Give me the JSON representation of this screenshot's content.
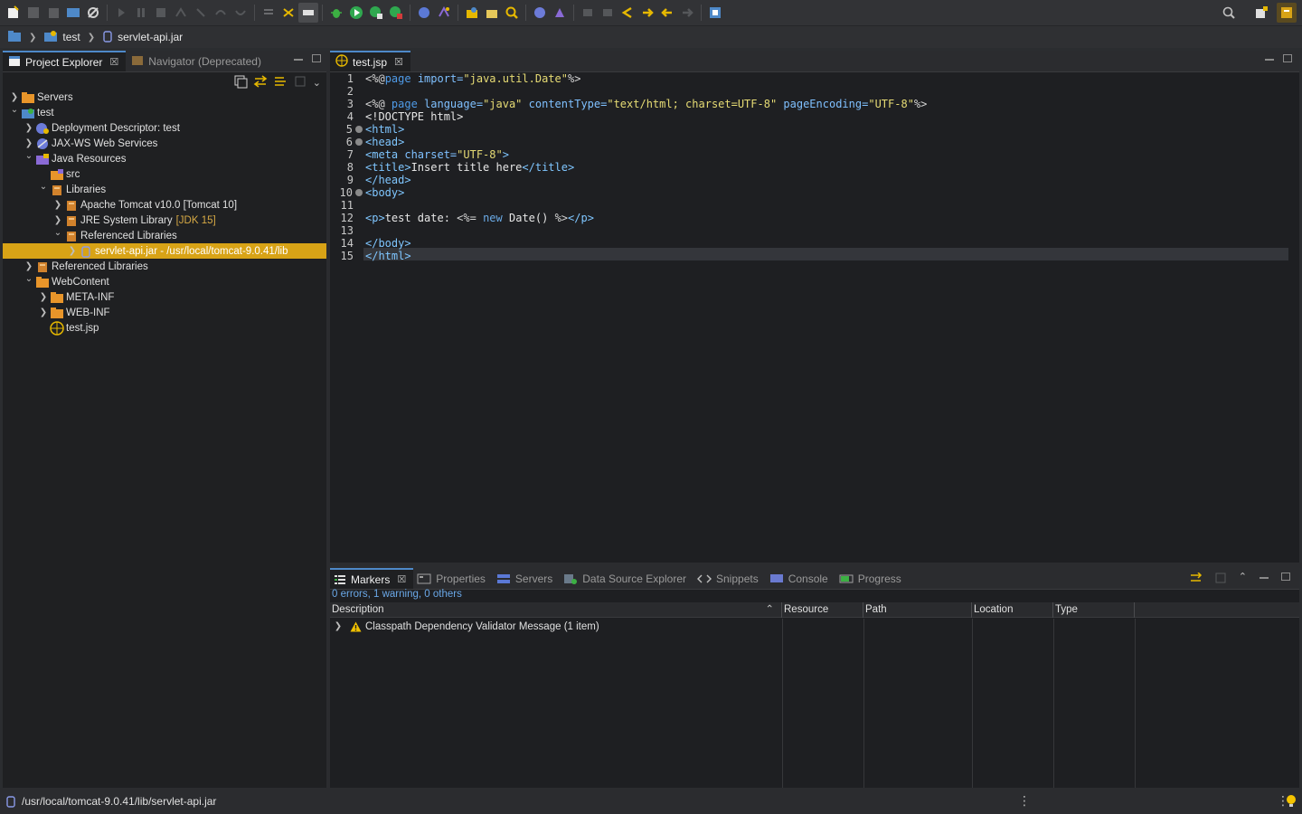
{
  "breadcrumb": {
    "items": [
      {
        "label": "",
        "icon": "workspace-folder-icon"
      },
      {
        "label": "test",
        "icon": "project-icon"
      },
      {
        "label": "servlet-api.jar",
        "icon": "jar-icon"
      }
    ]
  },
  "explorer": {
    "tabs": [
      {
        "label": "Project Explorer",
        "active": true
      },
      {
        "label": "Navigator (Deprecated)",
        "active": false
      }
    ],
    "tree": [
      {
        "label": "Servers",
        "indent": 0,
        "expanded": false,
        "icon": "folder-icon"
      },
      {
        "label": "test",
        "indent": 0,
        "expanded": true,
        "icon": "web-project-icon"
      },
      {
        "label": "Deployment Descriptor: test",
        "indent": 1,
        "expanded": false,
        "icon": "deployment-descriptor-icon"
      },
      {
        "label": "JAX-WS Web Services",
        "indent": 1,
        "expanded": false,
        "icon": "web-services-icon"
      },
      {
        "label": "Java Resources",
        "indent": 1,
        "expanded": true,
        "icon": "java-resources-icon"
      },
      {
        "label": "src",
        "indent": 2,
        "expanded": null,
        "icon": "package-folder-icon"
      },
      {
        "label": "Libraries",
        "indent": 2,
        "expanded": true,
        "icon": "library-icon"
      },
      {
        "label": "Apache Tomcat v10.0 [Tomcat 10]",
        "indent": 3,
        "expanded": false,
        "icon": "library-icon"
      },
      {
        "label": "JRE System Library",
        "deco": "[JDK 15]",
        "indent": 3,
        "expanded": false,
        "icon": "library-icon"
      },
      {
        "label": "Referenced Libraries",
        "indent": 3,
        "expanded": true,
        "icon": "library-icon"
      },
      {
        "label": "servlet-api.jar - /usr/local/tomcat-9.0.41/lib",
        "indent": 4,
        "expanded": false,
        "icon": "jar-icon",
        "selected": true
      },
      {
        "label": "Referenced Libraries",
        "indent": 1,
        "expanded": false,
        "icon": "library-icon"
      },
      {
        "label": "WebContent",
        "indent": 1,
        "expanded": true,
        "icon": "folder-icon"
      },
      {
        "label": "META-INF",
        "indent": 2,
        "expanded": false,
        "icon": "folder-icon"
      },
      {
        "label": "WEB-INF",
        "indent": 2,
        "expanded": false,
        "icon": "folder-icon"
      },
      {
        "label": "test.jsp",
        "indent": 2,
        "expanded": null,
        "icon": "jsp-file-icon"
      }
    ]
  },
  "editor": {
    "tab": {
      "label": "test.jsp"
    },
    "current_line": 15,
    "lines": [
      {
        "n": "1",
        "fold": false
      },
      {
        "n": "2",
        "fold": false
      },
      {
        "n": "3",
        "fold": false
      },
      {
        "n": "4",
        "fold": false
      },
      {
        "n": "5",
        "fold": true
      },
      {
        "n": "6",
        "fold": true
      },
      {
        "n": "7",
        "fold": false
      },
      {
        "n": "8",
        "fold": false
      },
      {
        "n": "9",
        "fold": false
      },
      {
        "n": "10",
        "fold": true
      },
      {
        "n": "11",
        "fold": false
      },
      {
        "n": "12",
        "fold": false
      },
      {
        "n": "13",
        "fold": false
      },
      {
        "n": "14",
        "fold": false
      },
      {
        "n": "15",
        "fold": false
      }
    ],
    "code": {
      "l1": [
        "<%@",
        "page",
        " import=",
        "\"java.util.Date\"",
        "%>"
      ],
      "l3": [
        "<%@ ",
        "page",
        " language=",
        "\"java\"",
        " contentType=",
        "\"text/html; charset=UTF-8\"",
        " pageEncoding=",
        "\"UTF-8\"",
        "%>"
      ],
      "l4": "<!DOCTYPE html>",
      "l5": "<html>",
      "l6": "<head>",
      "l7": [
        "<meta ",
        "charset=",
        "\"UTF-8\"",
        ">"
      ],
      "l8": [
        "<title>",
        "Insert title here",
        "</title>"
      ],
      "l9": "</head>",
      "l10": "<body>",
      "l12": [
        "<p>",
        "test date: ",
        "<%= ",
        "new",
        " Date() ",
        "%>",
        "</p>"
      ],
      "l14": "</body>",
      "l15": "</html>"
    }
  },
  "bottom": {
    "tabs": [
      {
        "label": "Markers",
        "active": true,
        "icon": "markers-icon"
      },
      {
        "label": "Properties",
        "active": false,
        "icon": "properties-icon"
      },
      {
        "label": "Servers",
        "active": false,
        "icon": "servers-icon"
      },
      {
        "label": "Data Source Explorer",
        "active": false,
        "icon": "data-source-icon"
      },
      {
        "label": "Snippets",
        "active": false,
        "icon": "snippets-icon"
      },
      {
        "label": "Console",
        "active": false,
        "icon": "console-icon"
      },
      {
        "label": "Progress",
        "active": false,
        "icon": "progress-icon"
      }
    ],
    "summary": "0 errors, 1 warning, 0 others",
    "columns": [
      "Description",
      "Resource",
      "Path",
      "Location",
      "Type"
    ],
    "rows": [
      {
        "description": "Classpath Dependency Validator Message (1 item)",
        "icon": "warning-icon"
      }
    ]
  },
  "statusbar": {
    "path": "/usr/local/tomcat-9.0.41/lib/servlet-api.jar"
  },
  "colors": {
    "selection": "#d8a316",
    "accent": "#4e89c9",
    "string": "#e6db74"
  }
}
